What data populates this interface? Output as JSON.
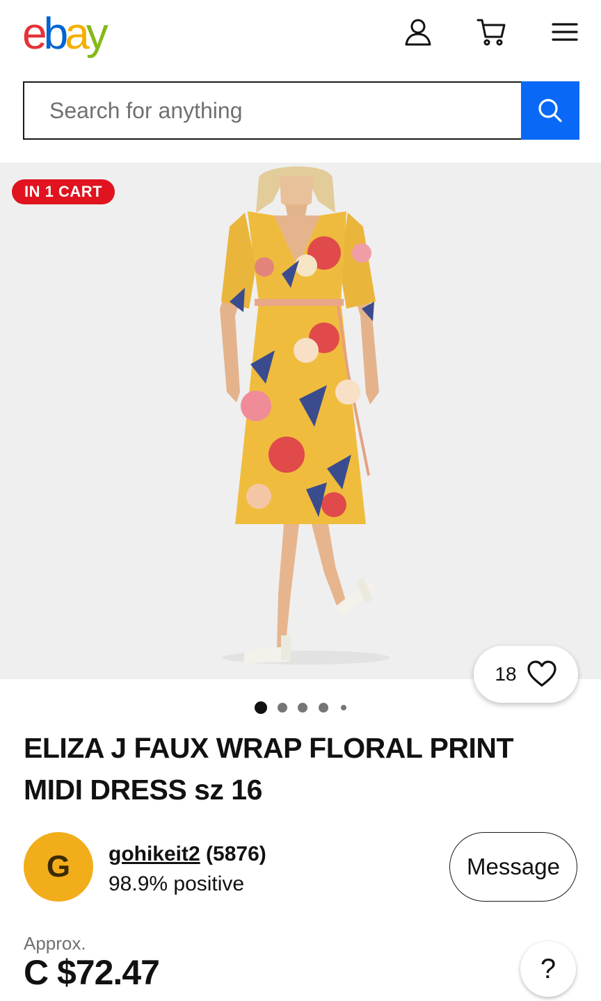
{
  "header": {
    "logo": {
      "letters": [
        "e",
        "b",
        "a",
        "y"
      ],
      "colors": [
        "#e53238",
        "#0064d2",
        "#f5af02",
        "#86b817"
      ]
    },
    "icons": [
      "account-icon",
      "cart-icon",
      "menu-icon"
    ]
  },
  "search": {
    "placeholder": "Search for anything",
    "value": "",
    "button_icon": "search-icon",
    "button_color": "#0968f6"
  },
  "listing": {
    "badge": "IN 1 CART",
    "badge_color": "#e0131f",
    "image_description": "Woman wearing a yellow floral faux wrap midi dress and white heeled sandals",
    "watch_count": "18",
    "image_count": 5,
    "active_image": 1,
    "title": "ELIZA J FAUX WRAP FLORAL PRINT MIDI DRESS sz 16"
  },
  "seller": {
    "initial": "G",
    "avatar_color": "#f2ad1b",
    "name": "gohikeit2",
    "feedback_count": "(5876)",
    "feedback": "98.9% positive",
    "message_label": "Message"
  },
  "price": {
    "approx_label": "Approx.",
    "value": "C $72.47"
  },
  "help": {
    "label": "?"
  }
}
